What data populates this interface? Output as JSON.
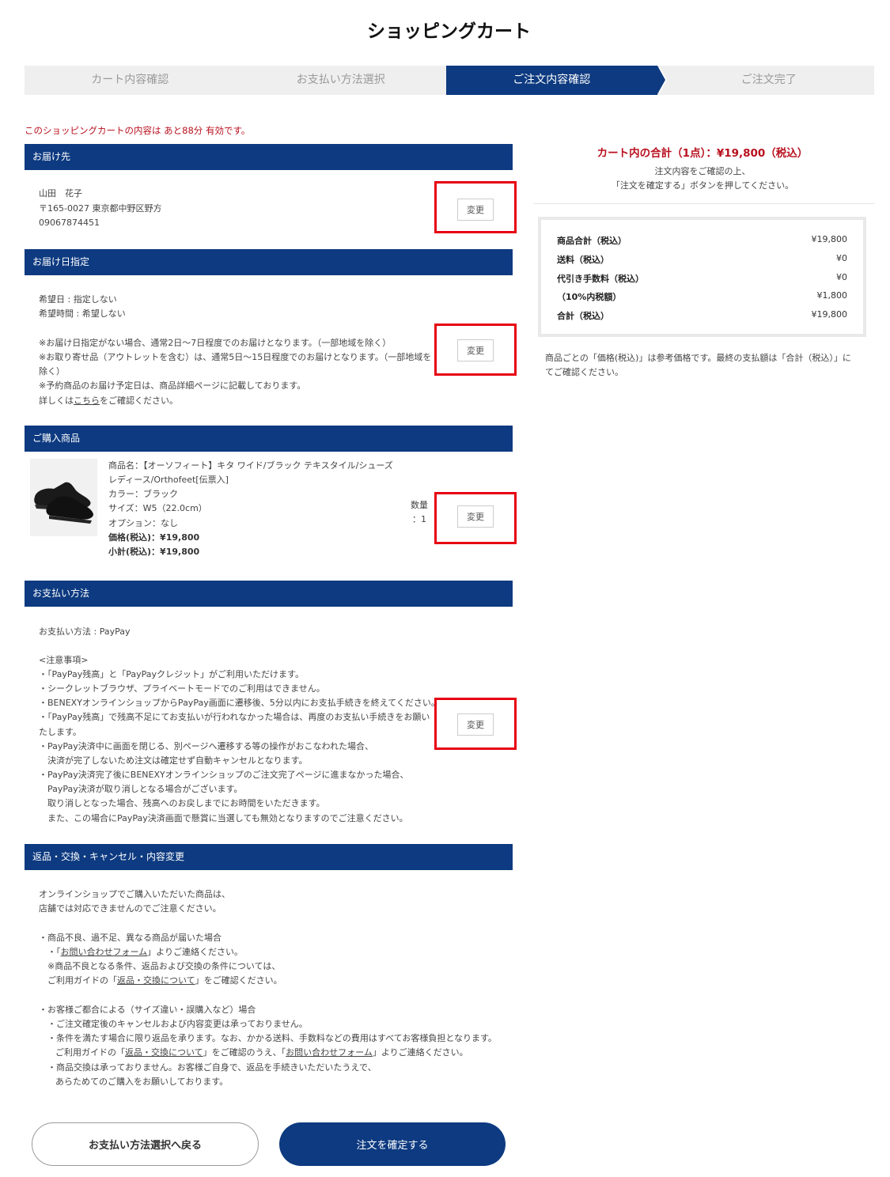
{
  "header": {
    "title": "ショッピングカート"
  },
  "steps": [
    "カート内容確認",
    "お支払い方法選択",
    "ご注文内容確認",
    "ご注文完了"
  ],
  "notice": "このショッピングカートの内容は あと88分 有効です。",
  "change_label": "変更",
  "delivery": {
    "heading": "お届け先",
    "name": "山田　花子",
    "address": "〒165-0027 東京都中野区野方",
    "phone": "09067874451"
  },
  "delivery_date": {
    "heading": "お届け日指定",
    "date": "希望日 : 指定しない",
    "time": "希望時間 : 希望しない",
    "note1": "※お届け日指定がない場合、通常2日～7日程度でのお届けとなります。（一部地域を除く）",
    "note2a": "※お取り寄せ品（アウトレットを含む）は、通常5日～15日程度でのお届けとなります。（一部地域を",
    "note2b": "除く）",
    "note3": "※予約商品のお届け予定日は、商品詳細ページに記載しております。",
    "detail_pre": "詳しくは",
    "detail_link": "こちら",
    "detail_post": "をご確認ください。"
  },
  "products": {
    "heading": "ご購入商品",
    "name_line1": "商品名：【オーソフィート】キタ ワイド/ブラック テキスタイル/シューズ",
    "name_line2": "レディース/Orthofeet[伝票入]",
    "color": "カラー：ブラック",
    "size": "サイズ：W5（22.0cm）",
    "option": "オプション：なし",
    "price": "価格(税込)：¥19,800",
    "subtotal": "小計(税込)：¥19,800",
    "qty_label": "数量",
    "qty_value": "：1"
  },
  "payment": {
    "heading": "お支払い方法",
    "method": "お支払い方法 : PayPay",
    "notes_title": "<注意事項>",
    "lines": [
      "・「PayPay残高」と「PayPayクレジット」がご利用いただけます。",
      "・シークレットブラウザ、プライベートモードでのご利用はできません。",
      "・BENEXYオンラインショップからPayPay画面に遷移後、5分以内にお支払手続きを終えてください。",
      "・「PayPay残高」で残高不足にてお支払いが行われなかった場合は、再度のお支払い手続きをお願い",
      "たします。",
      "・PayPay決済中に画面を閉じる、別ページへ遷移する等の操作がおこなわれた場合、",
      "　決済が完了しないため注文は確定せず自動キャンセルとなります。",
      "・PayPay決済完了後にBENEXYオンラインショップのご注文完了ページに進まなかった場合、",
      "　PayPay決済が取り消しとなる場合がございます。",
      "　取り消しとなった場合、残高へのお戻しまでにお時間をいただきます。",
      "　また、この場合にPayPay決済画面で懸賞に当選しても無効となりますのでご注意ください。"
    ]
  },
  "returns": {
    "heading": "返品・交換・キャンセル・内容変更",
    "l1": "オンラインショップでご購入いただいた商品は、",
    "l2": "店舗では対応できませんのでご注意ください。",
    "l3": "・商品不良、過不足、異なる商品が届いた場合",
    "l4_pre": "・「",
    "l4_link": "お問い合わせフォーム",
    "l4_post": "」よりご連絡ください。",
    "l5": "※商品不良となる条件、返品および交換の条件については、",
    "l6_pre": "ご利用ガイドの「",
    "l6_link": "返品・交換について",
    "l6_post": "」をご確認ください。",
    "l7": "・お客様ご都合による（サイズ違い・誤購入など）場合",
    "l8": "・ご注文確定後のキャンセルおよび内容変更は承っておりません。",
    "l9": "・条件を満たす場合に限り返品を承ります。なお、かかる送料、手数料などの費用はすべてお客様負担となります。",
    "l10_pre": "ご利用ガイドの「",
    "l10_link1": "返品・交換について",
    "l10_mid": "」をご確認のうえ、「",
    "l10_link2": "お問い合わせフォーム",
    "l10_post": "」よりご連絡ください。",
    "l11": "・商品交換は承っておりません。お客様ご自身で、返品を手続きいただいたうえで、",
    "l12": "あらためてのご購入をお願いしております。"
  },
  "summary": {
    "total": "カート内の合計（1点）：¥19,800（税込）",
    "note1": "注文内容をご確認の上、",
    "note2": "「注文を確定する」ボタンを押してください。",
    "rows": [
      {
        "label": "商品合計（税込）",
        "value": "¥19,800"
      },
      {
        "label": "送料（税込）",
        "value": "¥0"
      },
      {
        "label": "代引き手数料（税込）",
        "value": "¥0"
      },
      {
        "label": "（10%内税額）",
        "value": "¥1,800"
      },
      {
        "label": "合計（税込）",
        "value": "¥19,800"
      }
    ],
    "footnote1": "商品ごとの「価格(税込)」は参考価格です。最終の支払額は「合計（税込）」に",
    "footnote2": "てご確認ください。"
  },
  "buttons": {
    "back": "お支払い方法選択へ戻る",
    "confirm": "注文を確定する"
  }
}
